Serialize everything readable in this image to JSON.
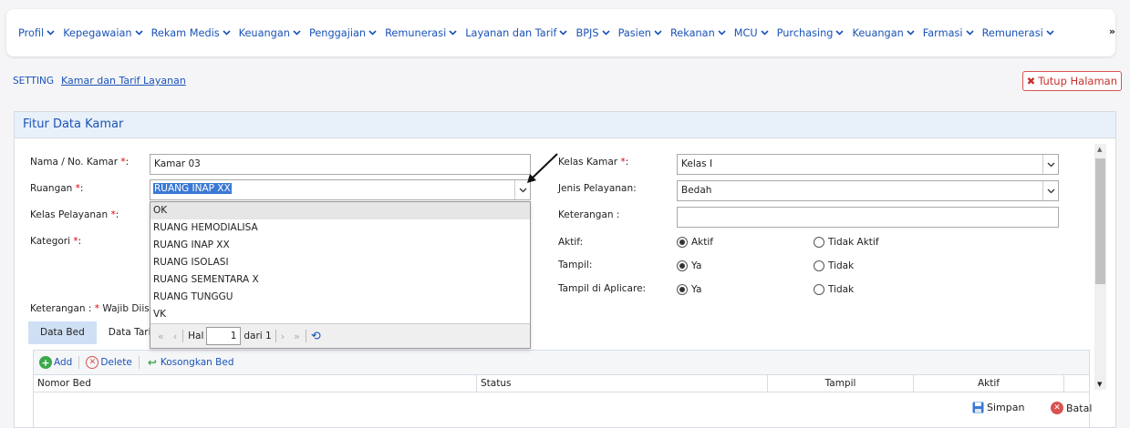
{
  "nav": {
    "items": [
      "Profil",
      "Kepegawaian",
      "Rekam Medis",
      "Keuangan",
      "Penggajian",
      "Remunerasi",
      "Layanan dan Tarif",
      "BPJS",
      "Pasien",
      "Rekanan",
      "MCU",
      "Purchasing",
      "Keuangan",
      "Farmasi",
      "Remunerasi"
    ],
    "more": "»"
  },
  "breadcrumb": {
    "section": "SETTING",
    "page": "Kamar dan Tarif Layanan"
  },
  "close_button": {
    "icon": "✖",
    "label": "Tutup Halaman"
  },
  "panel": {
    "title": "Fitur Data Kamar"
  },
  "form": {
    "nama_label": "Nama / No. Kamar ",
    "nama_value": "Kamar 03",
    "ruangan_label": "Ruangan ",
    "ruangan_value": "RUANG INAP XX",
    "kelas_pelayanan_label": "Kelas Pelayanan ",
    "kategori_label": "Kategori ",
    "keterangan_note": "Keterangan : ",
    "keterangan_note_star": "*",
    "keterangan_note_text": " Wajib Diisi",
    "kelas_kamar_label": "Kelas Kamar ",
    "kelas_kamar_value": "Kelas I",
    "jenis_pelayanan_label": "Jenis Pelayanan:",
    "jenis_pelayanan_value": "Bedah",
    "keterangan_label": "Keterangan :",
    "keterangan_value": "",
    "aktif_label": "Aktif:",
    "aktif_yes": "Aktif",
    "aktif_no": "Tidak Aktif",
    "tampil_label": "Tampil:",
    "tampil_yes": "Ya",
    "tampil_no": "Tidak",
    "aplicare_label": "Tampil di Aplicare:",
    "aplicare_yes": "Ya",
    "aplicare_no": "Tidak",
    "req_mark": "*",
    "colon": ":"
  },
  "dropdown": {
    "options": [
      "OK",
      "RUANG HEMODIALISA",
      "RUANG INAP XX",
      "RUANG ISOLASI",
      "RUANG SEMENTARA X",
      "RUANG TUNGGU",
      "VK"
    ],
    "hal_label": "Hal",
    "page_value": "1",
    "dari_label": "dari 1"
  },
  "tabs": [
    "Data Bed",
    "Data Tarif"
  ],
  "grid": {
    "add": "Add",
    "delete": "Delete",
    "kosongkan": "Kosongkan Bed",
    "columns": [
      "Nomor Bed",
      "Status",
      "Tampil",
      "Aktif"
    ]
  },
  "footer": {
    "simpan": "Simpan",
    "batal": "Batal"
  },
  "colors": {
    "accent": "#1a53b8",
    "danger": "#d9534f",
    "selection": "#3b79d4"
  }
}
